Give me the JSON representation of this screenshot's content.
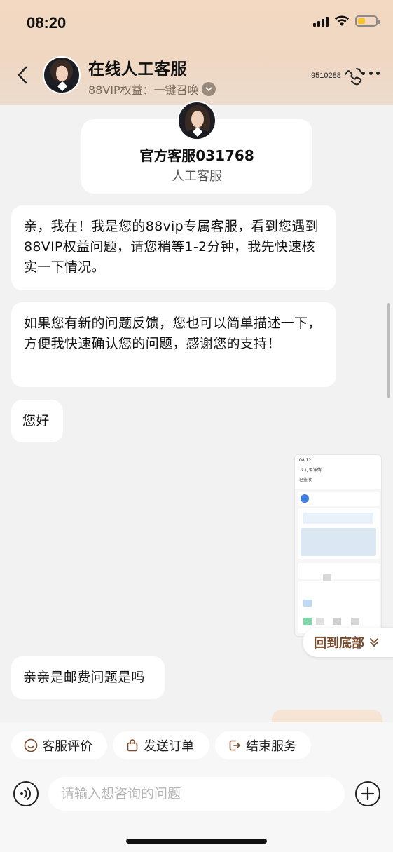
{
  "status_bar": {
    "time": "08:20"
  },
  "header": {
    "title": "在线人工客服",
    "subtitle": "88VIP权益：一键召唤",
    "phone_number": "9510288",
    "icons": [
      "back-icon",
      "phone-icon",
      "more-icon",
      "chevron-down-icon"
    ]
  },
  "agent_card": {
    "name": "官方客服031768",
    "role": "人工客服"
  },
  "messages": [
    {
      "from": "agent",
      "text": "亲，我在！我是您的88vip专属客服，看到您遇到88VIP权益问题，请您稍等1-2分钟，我先快速核实一下情况。"
    },
    {
      "from": "agent",
      "text": "如果您有新的问题反馈，您也可以简单描述一下，方便我快速确认您的问题，感谢您的支持！"
    },
    {
      "from": "agent",
      "text": "您好"
    },
    {
      "from": "user",
      "type": "image",
      "thumbnail": {
        "time": "08:12",
        "title": "〈 订单详情",
        "status": "已签收"
      }
    },
    {
      "from": "agent",
      "text": "亲亲是邮费问题是吗"
    }
  ],
  "back_to_bottom": {
    "label": "回到底部"
  },
  "quick_actions": [
    {
      "label": "客服评价",
      "icon": "smiley-icon"
    },
    {
      "label": "发送订单",
      "icon": "bag-icon"
    },
    {
      "label": "结束服务",
      "icon": "exit-icon"
    }
  ],
  "input": {
    "placeholder": "请输入想咨询的问题",
    "value": ""
  },
  "colors": {
    "header_gradient": "#f3d9c1",
    "accent_brown": "#7a4a2a",
    "background": "#f2f2f2",
    "battery_yellow": "#f5c527"
  }
}
